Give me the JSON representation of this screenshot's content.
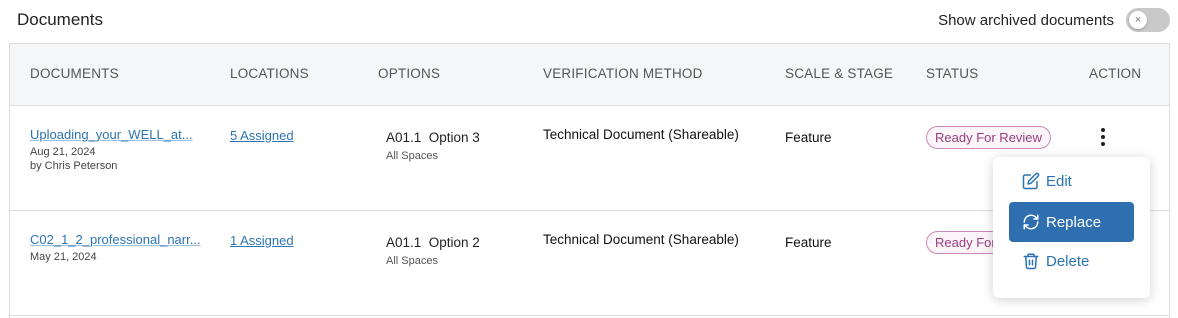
{
  "header": {
    "title": "Documents",
    "archived_toggle_label": "Show archived documents",
    "archived_toggle_glyph": "×"
  },
  "columns": [
    "DOCUMENTS",
    "LOCATIONS",
    "OPTIONS",
    "VERIFICATION METHOD",
    "SCALE & STAGE",
    "STATUS",
    "ACTION"
  ],
  "rows": [
    {
      "doc_name": "Uploading_your_WELL_at...",
      "date": "Aug 21, 2024",
      "by": "by Chris Peterson",
      "locations": "5 Assigned",
      "option": "A01.1  Option 3",
      "option_scope": "All Spaces",
      "verification": "Technical Document (Shareable)",
      "scale": "Feature",
      "status": "Ready For Review"
    },
    {
      "doc_name": "C02_1_2_professional_narr...",
      "date": "May 21, 2024",
      "by": "",
      "locations": "1 Assigned",
      "option": "A01.1  Option 2",
      "option_scope": "All Spaces",
      "verification": "Technical Document (Shareable)",
      "scale": "Feature",
      "status": "Ready For Review"
    }
  ],
  "action_menu": {
    "edit": "Edit",
    "replace": "Replace",
    "delete": "Delete"
  },
  "colors": {
    "link": "#2c73b3",
    "badge_text": "#9b3d7e",
    "badge_border": "#c98bb5",
    "menu_active": "#2f6fb0"
  },
  "icons": [
    "pencil-square-icon",
    "refresh-icon",
    "trash-icon",
    "kebab-menu-icon"
  ]
}
